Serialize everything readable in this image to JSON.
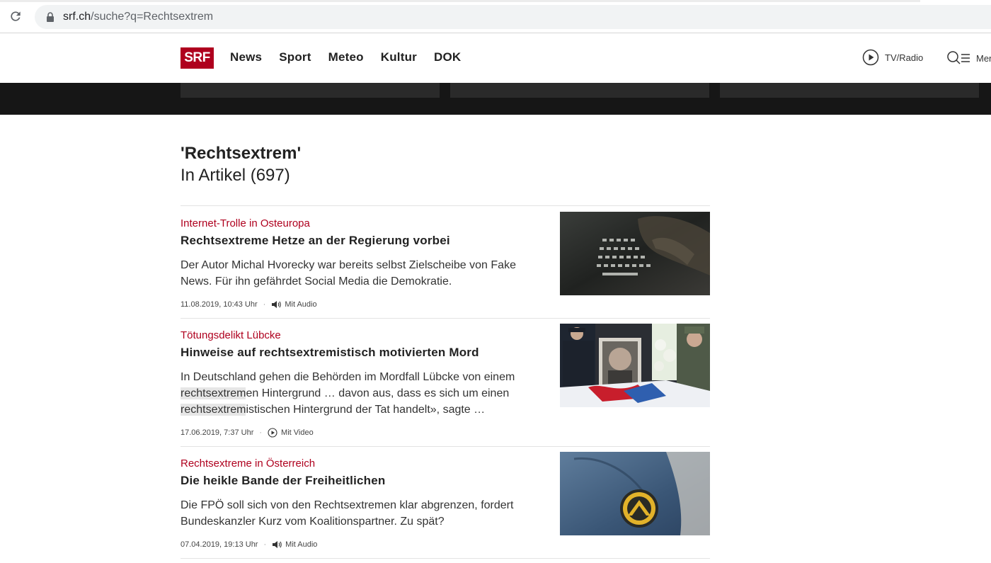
{
  "browser": {
    "url_host": "srf.ch",
    "url_path": "/suche?q=Rechtsextrem"
  },
  "header": {
    "logo_text": "SRF",
    "nav": [
      "News",
      "Sport",
      "Meteo",
      "Kultur",
      "DOK"
    ],
    "tvradio_label": "TV/Radio",
    "menu_label": "Menü"
  },
  "search": {
    "title": "'Rechtsextrem'",
    "count_label": "In Artikel (697)"
  },
  "results": [
    {
      "kicker": "Internet-Trolle in Osteuropa",
      "headline": "Rechtsextreme Hetze an der Regierung vorbei",
      "lead_line1": "Der Autor Michal Hvorecky war bereits selbst Zielscheibe von Fake",
      "lead_line2": "News. Für ihn gefährdet Social Media die Demokratie.",
      "date": "11.08.2019, 10:43 Uhr",
      "media": "Mit Audio",
      "media_icon": "speaker-icon"
    },
    {
      "kicker": "Tötungsdelikt Lübcke",
      "headline": "Hinweise auf rechtsextremistisch motivierten Mord",
      "lead_line1": "In Deutschland gehen die Behörden im Mordfall Lübcke von einem",
      "lead_hl1": "rechtsextrem",
      "lead_line2_rest": "en Hintergrund … davon aus, dass es sich um einen",
      "lead_hl2": "rechtsextrem",
      "lead_line3_rest": "istischen Hintergrund der Tat handelt», sagte …",
      "date": "17.06.2019, 7:37 Uhr",
      "media": "Mit Video",
      "media_icon": "play-icon"
    },
    {
      "kicker": "Rechtsextreme in Österreich",
      "headline": "Die heikle Bande der Freiheitlichen",
      "lead_line1": "Die FPÖ soll sich von den Rechtsextremen klar abgrenzen, fordert",
      "lead_line2": "Bundeskanzler Kurz vom Koalitionspartner. Zu spät?",
      "date": "07.04.2019, 19:13 Uhr",
      "media": "Mit Audio",
      "media_icon": "speaker-icon"
    }
  ],
  "colors": {
    "brand_red": "#af001e",
    "dark_strip": "#161616"
  }
}
